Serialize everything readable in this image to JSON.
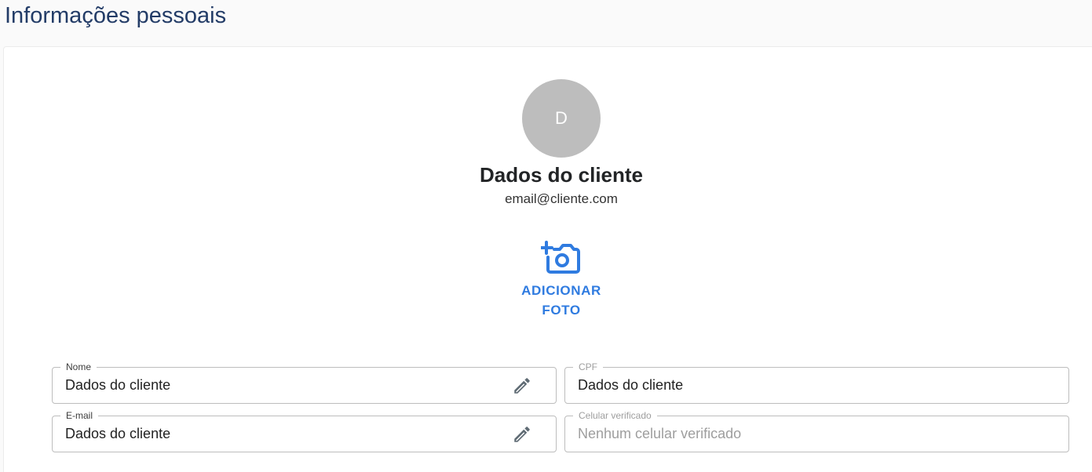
{
  "page": {
    "title": "Informações pessoais"
  },
  "profile": {
    "avatar_initial": "D",
    "name": "Dados do cliente",
    "email": "email@cliente.com",
    "add_photo_label": "ADICIONAR\nFOTO"
  },
  "form": {
    "nome": {
      "label": "Nome",
      "value": "Dados do cliente"
    },
    "cpf": {
      "label": "CPF",
      "value": "Dados do cliente"
    },
    "email": {
      "label": "E-mail",
      "value": "Dados do cliente"
    },
    "celular": {
      "label": "Celular verificado",
      "value": "",
      "placeholder": "Nenhum celular verificado"
    }
  },
  "colors": {
    "title": "#233c67",
    "accent": "#2f7be0",
    "avatar_bg": "#bdbdbd",
    "border": "#bdbdbd",
    "edit_icon": "#5f6b74"
  },
  "icons": {
    "add_photo": "add-a-photo-icon",
    "edit": "pencil-icon"
  }
}
